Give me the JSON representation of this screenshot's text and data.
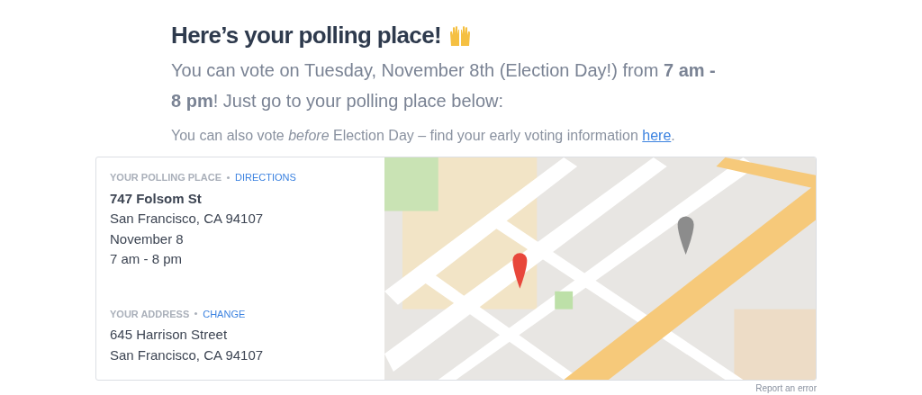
{
  "heading": "Here’s your polling place!",
  "intro": "You can vote on Tuesday, November 8th (Election Day!) from **7 am - 8 pm**! Just go to your polling place below:",
  "early_voting": {
    "text": "You can also vote *before* Election Day – find your early voting information",
    "link": "here",
    "end": "."
  },
  "polling_place": {
    "label": "YOUR POLLING PLACE",
    "action": "DIRECTIONS",
    "lines": [
      "747 Folsom St",
      "San Francisco, CA 94107",
      "November 8",
      "7 am - 8 pm"
    ]
  },
  "your_address": {
    "label": "YOUR ADDRESS",
    "action": "CHANGE",
    "lines": [
      "645 Harrison Street",
      "San Francisco, CA 94107"
    ]
  },
  "report_link": "Report an error"
}
